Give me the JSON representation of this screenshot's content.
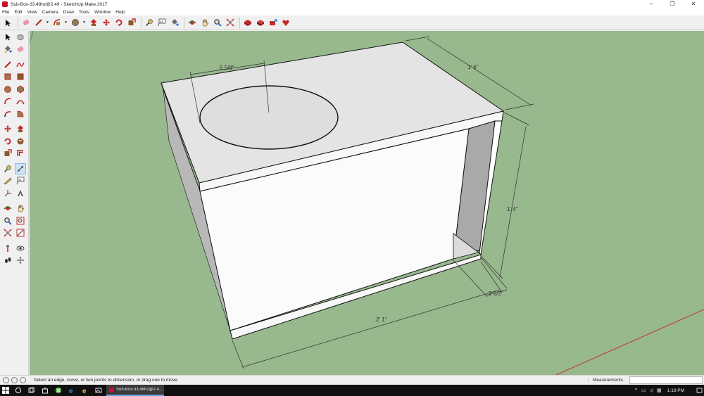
{
  "window": {
    "title": "Sub-Box-33.48hz@2.49 - SketchUp Make 2017",
    "minimize": "–",
    "restore": "❐",
    "close": "✕"
  },
  "menu": [
    "File",
    "Edit",
    "View",
    "Camera",
    "Draw",
    "Tools",
    "Window",
    "Help"
  ],
  "toolbar_icons": [
    "select-icon",
    "eraser-icon",
    "line-icon",
    "arc-icon",
    "shape-icon",
    "push-pull-icon",
    "move-icon",
    "rotate-icon",
    "scale-icon",
    "tape-measure-icon",
    "text-icon",
    "paint-bucket-icon",
    "orbit-icon",
    "pan-icon",
    "zoom-icon",
    "zoom-extents-icon",
    "warehouse-icon",
    "extension-icon",
    "share-icon",
    "extension-warehouse-icon"
  ],
  "left_toolbar_icons": [
    [
      "select-icon",
      "make-component-icon"
    ],
    [
      "paint-bucket-icon",
      "eraser-icon"
    ],
    [
      "line-icon",
      "freehand-icon"
    ],
    [
      "rectangle-icon",
      "rotated-rectangle-icon"
    ],
    [
      "circle-icon",
      "polygon-icon"
    ],
    [
      "arc-icon",
      "two-point-arc-icon"
    ],
    [
      "three-point-arc-icon",
      "pie-icon"
    ],
    [
      "move-icon",
      "push-pull-icon"
    ],
    [
      "rotate-icon",
      "follow-me-icon"
    ],
    [
      "scale-icon",
      "offset-icon"
    ],
    [
      "tape-measure-icon",
      "dimension-icon"
    ],
    [
      "protractor-icon",
      "text-icon"
    ],
    [
      "axes-icon",
      "3d-text-icon"
    ],
    [
      "orbit-icon",
      "pan-icon"
    ],
    [
      "zoom-icon",
      "zoom-window-icon"
    ],
    [
      "zoom-extents-icon",
      "previous-view-icon"
    ],
    [
      "position-camera-icon",
      "look-around-icon"
    ],
    [
      "walk-icon",
      "section-plane-icon"
    ]
  ],
  "model": {
    "dimensions": {
      "width": "2' 1\"",
      "depth": "1' 6\"",
      "height": "1' 4\"",
      "port_width": "2 1/2\"",
      "hole_radius": "5 5/8\""
    },
    "colors": {
      "sky_ground": "#98b88e",
      "face_top": "#e4e4e4",
      "face_front": "#fbfbfb",
      "face_side": "#c4c4c4",
      "port_inside": "#a9a9a9",
      "axis_red": "#c0392b",
      "axis_green": "#2e8b57"
    }
  },
  "status": {
    "message": "Select an edge, curve, or two points to dimension, or drag one to move.",
    "measurements_label": "Measurements",
    "measurements_value": ""
  },
  "taskbar": {
    "app_label": "Sub-Box-33.48hz@2.4...",
    "time": "1:18 PM"
  }
}
